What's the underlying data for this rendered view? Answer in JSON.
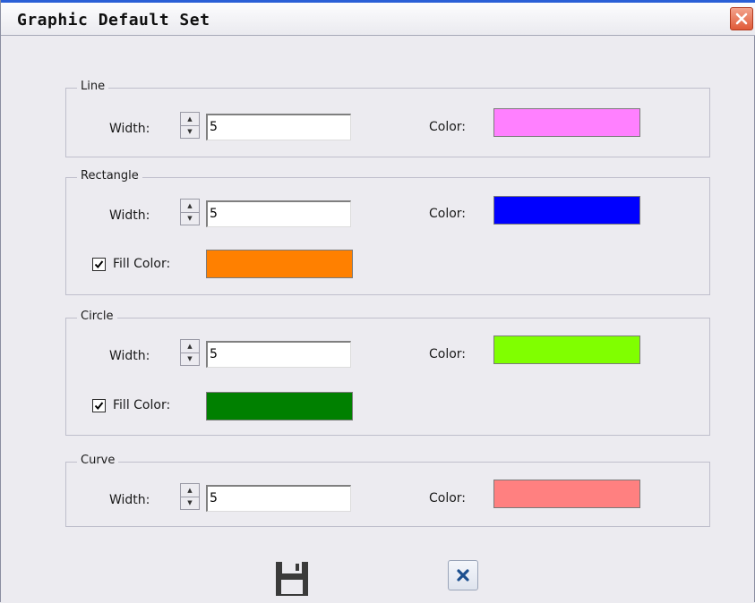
{
  "window": {
    "title": "Graphic Default Set"
  },
  "line": {
    "legend": "Line",
    "width_label": "Width:",
    "width_value": "5",
    "color_label": "Color:",
    "color": "#ff80ff"
  },
  "rectangle": {
    "legend": "Rectangle",
    "width_label": "Width:",
    "width_value": "5",
    "color_label": "Color:",
    "color": "#0000ff",
    "fill_label": "Fill Color:",
    "fill_checked": true,
    "fill_color": "#ff8000"
  },
  "circle": {
    "legend": "Circle",
    "width_label": "Width:",
    "width_value": "5",
    "color_label": "Color:",
    "color": "#80ff00",
    "fill_label": "Fill Color:",
    "fill_checked": true,
    "fill_color": "#008000"
  },
  "curve": {
    "legend": "Curve",
    "width_label": "Width:",
    "width_value": "5",
    "color_label": "Color:",
    "color": "#ff8080"
  },
  "icons": {
    "close": "close-icon",
    "save": "floppy-disk-icon",
    "cancel": "x-icon",
    "spin_up": "arrow-up-icon",
    "spin_down": "arrow-down-icon",
    "check": "checkmark-icon"
  }
}
